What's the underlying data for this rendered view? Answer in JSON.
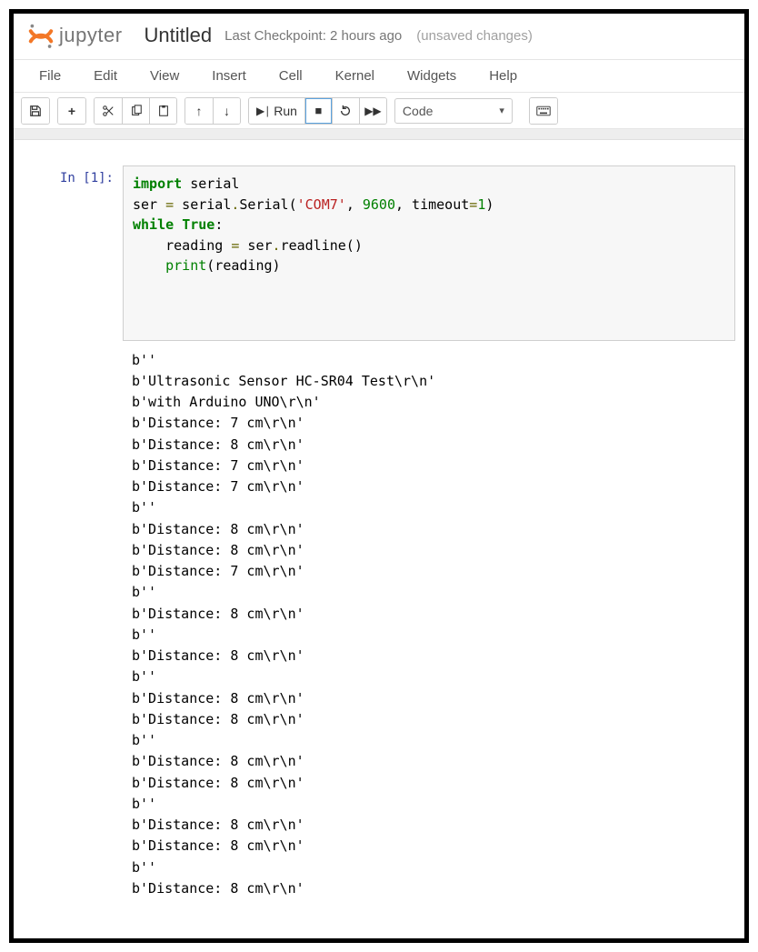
{
  "logo_text": "jupyter",
  "doc_title": "Untitled",
  "checkpoint_text": "Last Checkpoint: 2 hours ago",
  "unsaved_text": "(unsaved changes)",
  "menu": {
    "file": "File",
    "edit": "Edit",
    "view": "View",
    "insert": "Insert",
    "cell": "Cell",
    "kernel": "Kernel",
    "widgets": "Widgets",
    "help": "Help"
  },
  "toolbar": {
    "run_label": "Run",
    "cell_type": "Code"
  },
  "cell1": {
    "prompt": "In [1]:",
    "code_tokens": [
      {
        "t": "import",
        "c": "kw"
      },
      {
        "t": " serial\n"
      },
      {
        "t": "ser "
      },
      {
        "t": "=",
        "c": "op"
      },
      {
        "t": " serial"
      },
      {
        "t": ".",
        "c": "op"
      },
      {
        "t": "Serial("
      },
      {
        "t": "'COM7'",
        "c": "str"
      },
      {
        "t": ", "
      },
      {
        "t": "9600",
        "c": "num"
      },
      {
        "t": ", timeout"
      },
      {
        "t": "=",
        "c": "op"
      },
      {
        "t": "1",
        "c": "num"
      },
      {
        "t": ")\n"
      },
      {
        "t": "while",
        "c": "kw"
      },
      {
        "t": " "
      },
      {
        "t": "True",
        "c": "kw"
      },
      {
        "t": ":\n"
      },
      {
        "t": "    reading "
      },
      {
        "t": "=",
        "c": "op"
      },
      {
        "t": " ser"
      },
      {
        "t": ".",
        "c": "op"
      },
      {
        "t": "readline()\n"
      },
      {
        "t": "    "
      },
      {
        "t": "print",
        "c": "fn"
      },
      {
        "t": "(reading)"
      }
    ],
    "output_lines": [
      "b''",
      "b'Ultrasonic Sensor HC-SR04 Test\\r\\n'",
      "b'with Arduino UNO\\r\\n'",
      "b'Distance: 7 cm\\r\\n'",
      "b'Distance: 8 cm\\r\\n'",
      "b'Distance: 7 cm\\r\\n'",
      "b'Distance: 7 cm\\r\\n'",
      "b''",
      "b'Distance: 8 cm\\r\\n'",
      "b'Distance: 8 cm\\r\\n'",
      "b'Distance: 7 cm\\r\\n'",
      "b''",
      "b'Distance: 8 cm\\r\\n'",
      "b''",
      "b'Distance: 8 cm\\r\\n'",
      "b''",
      "b'Distance: 8 cm\\r\\n'",
      "b'Distance: 8 cm\\r\\n'",
      "b''",
      "b'Distance: 8 cm\\r\\n'",
      "b'Distance: 8 cm\\r\\n'",
      "b''",
      "b'Distance: 8 cm\\r\\n'",
      "b'Distance: 8 cm\\r\\n'",
      "b''",
      "b'Distance: 8 cm\\r\\n'"
    ]
  }
}
